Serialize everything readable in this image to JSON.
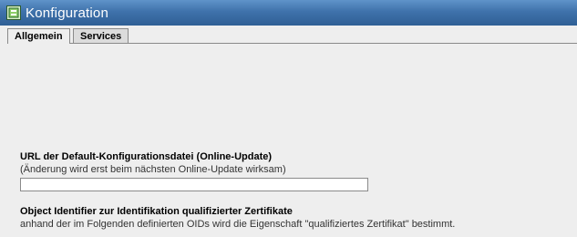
{
  "window": {
    "title": "Konfiguration",
    "icon": "configuration-icon"
  },
  "tabs": [
    {
      "label": "Allgemein",
      "active": true
    },
    {
      "label": "Services",
      "active": false
    }
  ],
  "sections": {
    "url": {
      "heading": "URL der Default-Konfigurationsdatei (Online-Update)",
      "hint": "(Änderung wird erst beim nächsten Online-Update wirksam)",
      "value": "",
      "placeholder": ""
    },
    "oid": {
      "heading": "Object Identifier zur Identifikation qualifizierter Zertifikate",
      "description": "anhand der im Folgenden definierten OIDs wird die Eigenschaft \"qualifiziertes Zertifikat\" bestimmt."
    }
  },
  "colors": {
    "titlebar": "#3f72ab",
    "background": "#eeeeee",
    "border": "#8a8a8a"
  }
}
